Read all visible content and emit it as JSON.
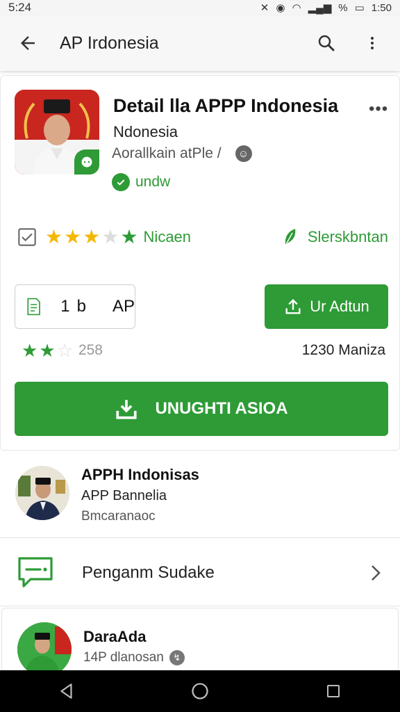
{
  "status_bar": {
    "time": "5:24",
    "clock": "1:50",
    "battery_symbol": "%"
  },
  "app_bar": {
    "title": "AP Irdonesia"
  },
  "app": {
    "title": "Detail lla APPP Indonesia",
    "developer": "Ndonesia",
    "subtitle": "Aorallkain atPle /",
    "verified_label": "undw"
  },
  "rating_row": {
    "stars_gold": 3,
    "stars_total": 5,
    "label": "Nicaen",
    "right_label": "Slerskbntan"
  },
  "size_button": {
    "value": "1b",
    "label": "AP"
  },
  "action_button": {
    "label": "Ur Adtun"
  },
  "stats": {
    "stars_green": 2,
    "count": "258",
    "downloads": "1230 Maniza"
  },
  "install_button": {
    "label": "UNUGHTI ASIOA"
  },
  "section_1": {
    "title": "APPH Indonisas",
    "subtitle": "APP Bannelia",
    "meta": "Bmcaranaoc"
  },
  "section_2": {
    "label": "Penganm Sudake"
  },
  "section_3": {
    "title": "DaraAda",
    "meta": "14P dlanosan"
  },
  "colors": {
    "accent": "#2e9b36",
    "star": "#f5b800",
    "icon_bg": "#c8261f"
  },
  "icons": {
    "back": "arrow-left-icon",
    "search": "search-icon",
    "overflow": "more-vert-icon",
    "message": "message-icon",
    "chevron": "chevron-right-icon"
  }
}
